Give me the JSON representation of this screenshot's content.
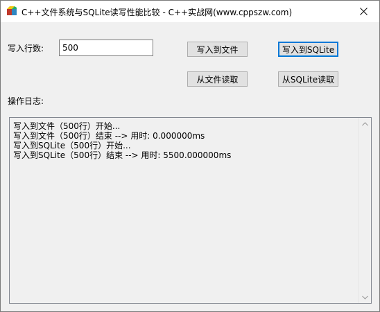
{
  "window": {
    "title": "C++文件系统与SQLite读写性能比较 - C++实战网(www.cppszw.com)",
    "icon": "app-icon",
    "close_symbol": "✕"
  },
  "form": {
    "rows_label": "写入行数:",
    "rows_value": "500",
    "log_label": "操作日志:"
  },
  "buttons": {
    "write_file": "写入到文件",
    "write_sqlite": "写入到SQLite",
    "read_file": "从文件读取",
    "read_sqlite": "从SQLite读取"
  },
  "log": {
    "lines": [
      "写入到文件（500行）开始...",
      "写入到文件（500行）结束 --> 用时: 0.000000ms",
      "写入到SQLite（500行）开始...",
      "写入到SQLite（500行）结束 --> 用时: 5500.000000ms"
    ]
  },
  "colors": {
    "accent": "#0078d7",
    "window_bg": "#f0f0f0",
    "button_bg": "#e1e1e1"
  }
}
